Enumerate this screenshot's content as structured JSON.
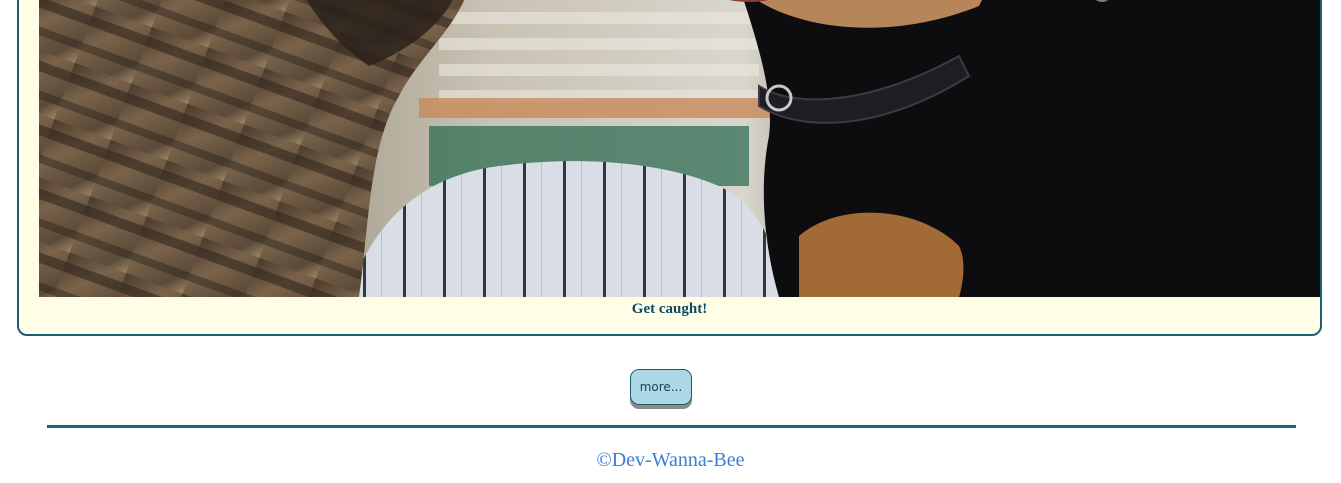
{
  "card": {
    "image_alt": "cat and dog",
    "caption": "Get caught!"
  },
  "more_button": {
    "label": "more..."
  },
  "footer": {
    "copyright": "©Dev-Wanna-Bee"
  },
  "colors": {
    "card_bg": "#fffde5",
    "card_border": "#1c5f73",
    "caption_text": "#0b4a63",
    "button_bg": "#add8e6",
    "divider": "#15657c",
    "footer_text": "#3b7ed6"
  }
}
